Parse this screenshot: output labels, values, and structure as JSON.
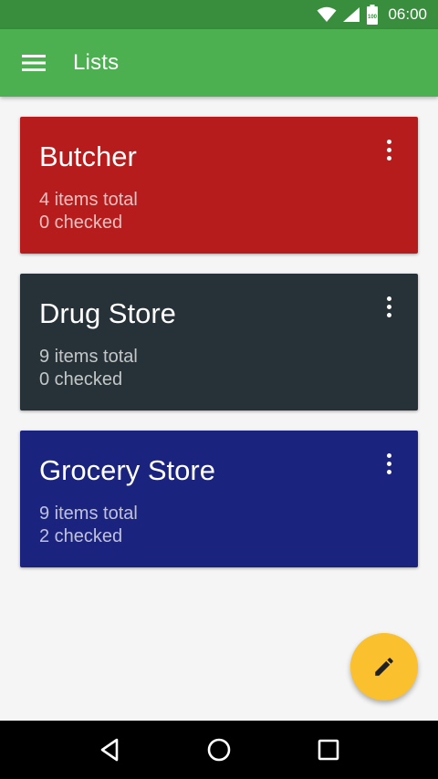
{
  "status_bar": {
    "time": "06:00",
    "battery_text": "100",
    "icons": [
      "wifi-icon",
      "signal-icon",
      "battery-icon"
    ]
  },
  "app_bar": {
    "title": "Lists",
    "menu_icon": "hamburger-menu-icon",
    "color": "#4caf50"
  },
  "lists": [
    {
      "name": "Butcher",
      "total": "4 items total",
      "checked": "0 checked",
      "color": "#b71c1c"
    },
    {
      "name": "Drug Store",
      "total": "9 items total",
      "checked": "0 checked",
      "color": "#263238"
    },
    {
      "name": "Grocery Store",
      "total": "9 items total",
      "checked": "2 checked",
      "color": "#1a237e"
    }
  ],
  "fab": {
    "icon": "edit-pencil-icon",
    "color": "#fbc02d"
  },
  "nav_bar": {
    "icons": [
      "back-icon",
      "home-icon",
      "recents-icon"
    ]
  }
}
